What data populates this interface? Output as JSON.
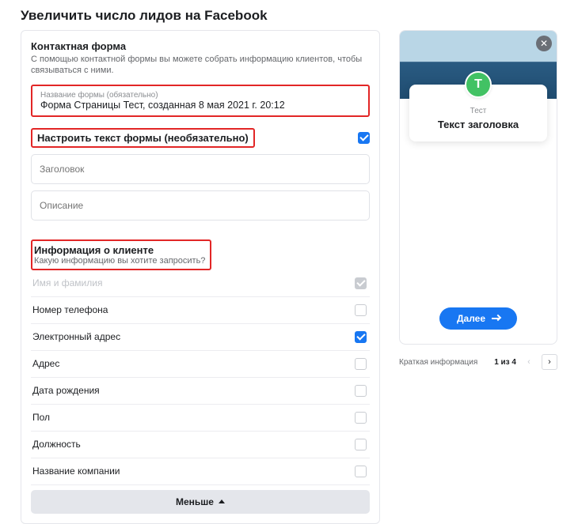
{
  "page_title": "Увеличить число лидов на Facebook",
  "contact_form": {
    "title": "Контактная форма",
    "subtitle": "С помощью контактной формы вы можете собрать информацию клиентов, чтобы связываться с ними."
  },
  "form_name": {
    "label": "Название формы (обязательно)",
    "value": "Форма Страницы Тест, созданная 8 мая 2021 г. 20:12"
  },
  "form_text": {
    "title": "Настроить текст формы (необязательно)",
    "toggle_checked": true,
    "heading_placeholder": "Заголовок",
    "description_placeholder": "Описание"
  },
  "client_info": {
    "title": "Информация о клиенте",
    "subtitle": "Какую информацию вы хотите запросить?",
    "fields": [
      {
        "label": "Имя и фамилия",
        "checked": true,
        "disabled": true
      },
      {
        "label": "Номер телефона",
        "checked": false,
        "disabled": false
      },
      {
        "label": "Электронный адрес",
        "checked": true,
        "disabled": false
      },
      {
        "label": "Адрес",
        "checked": false,
        "disabled": false
      },
      {
        "label": "Дата рождения",
        "checked": false,
        "disabled": false
      },
      {
        "label": "Пол",
        "checked": false,
        "disabled": false
      },
      {
        "label": "Должность",
        "checked": false,
        "disabled": false
      },
      {
        "label": "Название компании",
        "checked": false,
        "disabled": false
      }
    ]
  },
  "less_button": "Меньше",
  "preview": {
    "avatar_letter": "Т",
    "brand_name": "Тест",
    "headline": "Текст заголовка",
    "next_button": "Далее"
  },
  "pager": {
    "label": "Краткая информация",
    "position": "1 из 4"
  }
}
